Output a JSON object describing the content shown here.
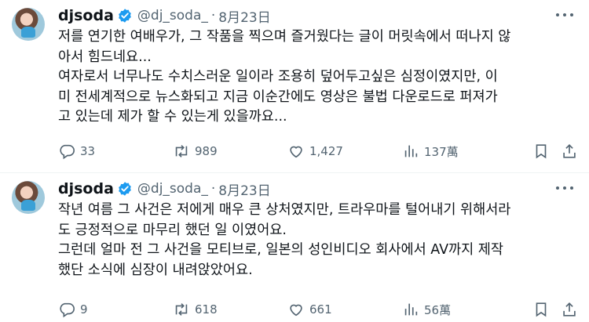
{
  "tweets": [
    {
      "name": "djsoda",
      "handle": "@dj_soda_",
      "separator": "·",
      "date": "8月23日",
      "text_lines": [
        "저를 연기한 여배우가, 그 작품을 찍으며 즐거웠다는 글이 머릿속에서 떠나지 않",
        "아서 힘드네요...",
        "여자로서 너무나도 수치스러운 일이라 조용히 덮어두고싶은 심정이였지만, 이",
        "미 전세계적으로 뉴스화되고 지금 이순간에도 영상은 불법 다운로드로 퍼져가",
        "고 있는데 제가 할 수 있는게 있을까요..."
      ],
      "replies": "33",
      "retweets": "989",
      "likes": "1,427",
      "views": "137萬"
    },
    {
      "name": "djsoda",
      "handle": "@dj_soda_",
      "separator": "·",
      "date": "8月23日",
      "text_lines": [
        "작년 여름 그 사건은 저에게 매우 큰 상처였지만, 트라우마를 털어내기 위해서라",
        "도 긍정적으로 마무리 했던 일 이였어요.",
        "그런데 얼마 전 그 사건을 모티브로, 일본의 성인비디오 회사에서 AV까지 제작",
        "했단 소식에 심장이 내려앉았어요."
      ],
      "replies": "9",
      "retweets": "618",
      "likes": "661",
      "views": "56萬"
    }
  ],
  "icons": {
    "verified": "verified-badge-icon",
    "more": "more-dots-icon",
    "reply": "reply-bubble-icon",
    "retweet": "retweet-arrows-icon",
    "like": "heart-icon",
    "views": "views-bars-icon",
    "bookmark": "bookmark-icon",
    "share": "share-upload-icon"
  },
  "colors": {
    "verified": "#1d9bf0",
    "text": "#0f1419",
    "secondary": "#536471",
    "divider": "#eff3f4"
  }
}
